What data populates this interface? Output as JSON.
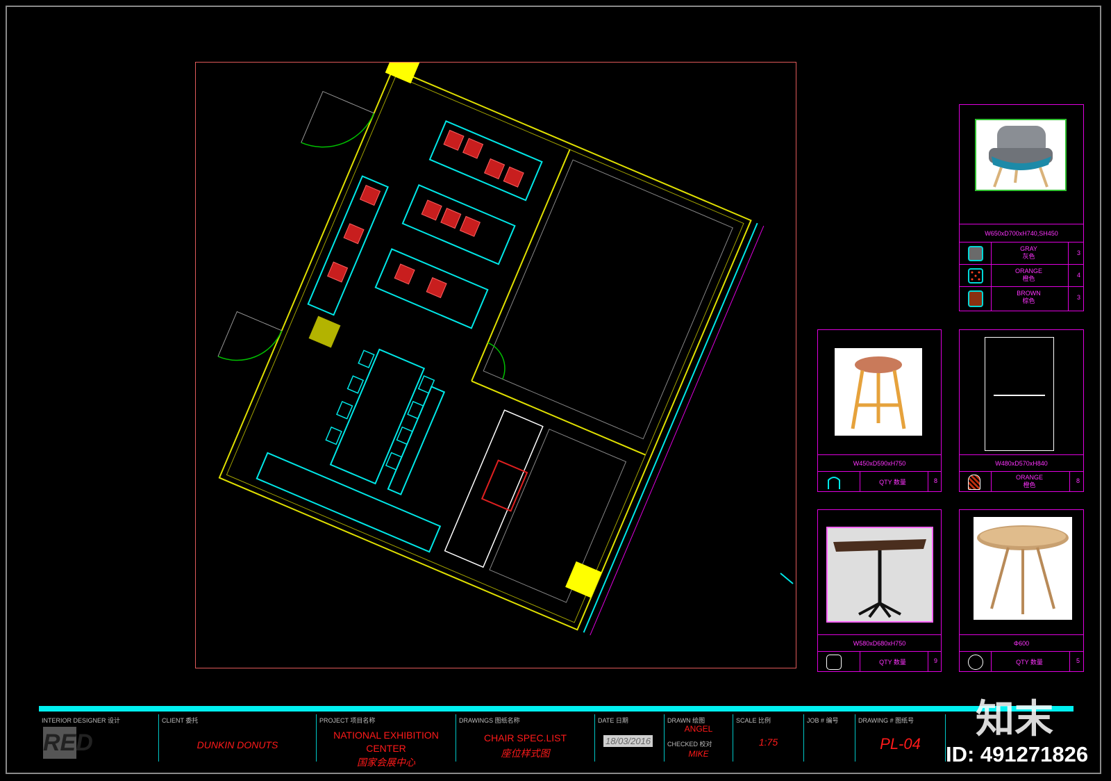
{
  "drawing": {
    "layers": {
      "wall": "#e0e000",
      "furniture": "#00e8e8",
      "fixture": "#ffffff",
      "highlight": "#ffff00",
      "door": "#00c000",
      "chair_fabric": "#c81e1e"
    }
  },
  "spec_cards": [
    {
      "id": "lounge-chair",
      "dims": "W650xD700xH740,SH450",
      "options": [
        {
          "color": "GRAY",
          "color_cn": "灰色",
          "qty": "3"
        },
        {
          "color": "ORANGE",
          "color_cn": "橙色",
          "qty": "4"
        },
        {
          "color": "BROWN",
          "color_cn": "棕色",
          "qty": "3"
        }
      ]
    },
    {
      "id": "bar-stool",
      "dims": "W450xD590xH750",
      "label": "QTY 数量",
      "qty": "8"
    },
    {
      "id": "bench",
      "dims": "W480xD570xH840",
      "label": "ORANGE",
      "label_cn": "橙色",
      "qty": "8"
    },
    {
      "id": "square-table",
      "dims": "W580xD680xH750",
      "label": "QTY 数量",
      "qty": "9"
    },
    {
      "id": "round-table",
      "dims": "Φ600",
      "label": "QTY 数量",
      "qty": "5"
    }
  ],
  "title_block": {
    "designer_label": "INTERIOR DESIGNER  设计",
    "designer_logo": "RED",
    "client_label": "CLIENT  委托",
    "client": "DUNKIN DONUTS",
    "project_label": "PROJECT 项目名称",
    "project_line1": "NATIONAL EXHIBITION",
    "project_line2": "CENTER",
    "project_cn": "国家会展中心",
    "drawings_label": "DRAWINGS 图纸名称",
    "drawings": "CHAIR SPEC.LIST",
    "drawings_cn": "座位样式图",
    "date_label": "DATE 日期",
    "date": "18/03/2016",
    "drawn_label": "DRAWN 绘图",
    "drawn": "ANGEL",
    "checked_label": "CHECKED 校对",
    "checked": "MIKE",
    "scale_label": "SCALE  比例",
    "scale": "1:75",
    "job_label": "JOB # 编号",
    "drawing_no_label": "DRAWING # 图纸号",
    "drawing_no": "PL-04"
  },
  "watermark": {
    "brand": "知末",
    "id": "ID: 491271826"
  }
}
